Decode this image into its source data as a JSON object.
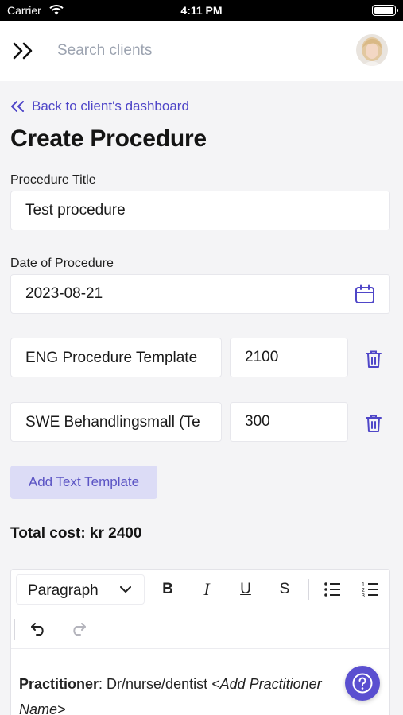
{
  "status_bar": {
    "carrier": "Carrier",
    "time": "4:11 PM"
  },
  "header": {
    "menu_icon": "double-chevron-right-icon",
    "search": {
      "placeholder": "Search clients",
      "value": ""
    }
  },
  "back_link": {
    "label": "Back to client's dashboard"
  },
  "page_title": "Create Procedure",
  "form": {
    "title_label": "Procedure Title",
    "title_value": "Test procedure",
    "date_label": "Date of Procedure",
    "date_value": "2023-08-21",
    "templates": [
      {
        "name": "ENG Procedure Template",
        "price": "2100"
      },
      {
        "name": "SWE Behandlingsmall (Te",
        "price": "300"
      }
    ],
    "add_template_button": "Add Text Template",
    "total": "Total cost: kr 2400"
  },
  "editor": {
    "block_type": "Paragraph",
    "toolbar": [
      "bold",
      "italic",
      "underline",
      "strikethrough",
      "bullet-list",
      "numbered-list",
      "undo",
      "redo"
    ],
    "body": {
      "label": "Practitioner",
      "text": ": Dr/nurse/dentist ",
      "placeholder_line1": "<Add Practitioner",
      "placeholder_line2": "Name>"
    }
  },
  "colors": {
    "accent": "#4f46c8",
    "button_bg": "#dcdcf6",
    "help_button": "#5a4fd0"
  }
}
